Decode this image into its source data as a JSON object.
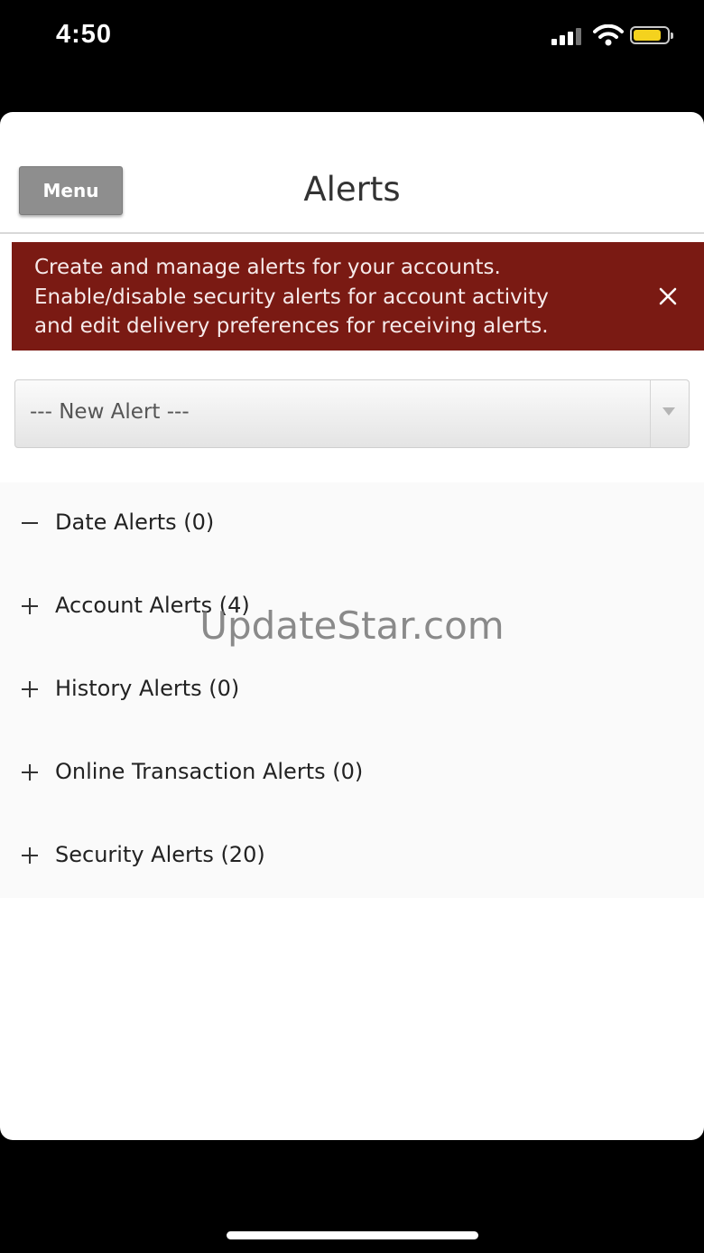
{
  "status_bar": {
    "time": "4:50"
  },
  "header": {
    "menu_label": "Menu",
    "title": "Alerts"
  },
  "banner": {
    "lines": [
      "Create and manage alerts for your accounts.",
      "Enable/disable security alerts for account activity",
      "and edit delivery preferences for receiving alerts."
    ]
  },
  "new_alert_select": {
    "selected": "--- New Alert ---"
  },
  "alert_groups": [
    {
      "label": "Date Alerts (0)",
      "icon": "minus-icon",
      "expanded": true
    },
    {
      "label": "Account Alerts (4)",
      "icon": "plus-icon",
      "expanded": false
    },
    {
      "label": "History Alerts (0)",
      "icon": "plus-icon",
      "expanded": false
    },
    {
      "label": "Online Transaction Alerts (0)",
      "icon": "plus-icon",
      "expanded": false
    },
    {
      "label": "Security Alerts (20)",
      "icon": "plus-icon",
      "expanded": false
    }
  ],
  "watermark": "UpdateStar.com",
  "colors": {
    "banner_bg": "#7a1a13",
    "menu_button": "#8e8e8e",
    "battery": "#f4d21e"
  }
}
